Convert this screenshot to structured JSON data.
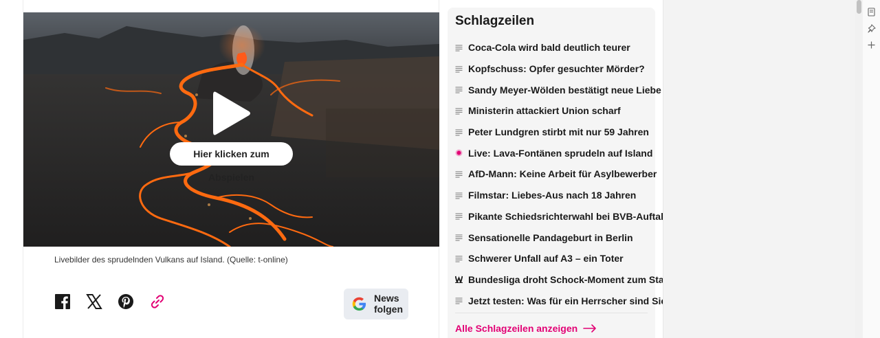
{
  "video": {
    "play_label": "Hier klicken zum Abspielen",
    "caption": "Livebilder des sprudelnden Vulkans auf Island. (Quelle: t-online)"
  },
  "share": {
    "icons": [
      "facebook-icon",
      "x-icon",
      "pinterest-icon",
      "link-icon"
    ]
  },
  "google_news": {
    "line1": "News",
    "line2": "folgen"
  },
  "headlines": {
    "title": "Schlagzeilen",
    "items": [
      {
        "text": "Coca-Cola wird bald deutlich teurer",
        "icon": "text-lines-icon"
      },
      {
        "text": "Kopfschuss: Opfer gesuchter Mörder?",
        "icon": "text-lines-icon"
      },
      {
        "text": "Sandy Meyer-Wölden bestätigt neue Liebe",
        "icon": "text-lines-icon"
      },
      {
        "text": "Ministerin attackiert Union scharf",
        "icon": "text-lines-icon"
      },
      {
        "text": "Peter Lundgren stirbt mit nur 59 Jahren",
        "icon": "text-lines-icon"
      },
      {
        "text": "Live: Lava-Fontänen sprudeln auf Island",
        "icon": "live-dot-icon"
      },
      {
        "text": "AfD-Mann: Keine Arbeit für Asylbewerber",
        "icon": "text-lines-icon"
      },
      {
        "text": "Filmstar: Liebes-Aus nach 18 Jahren",
        "icon": "text-lines-icon"
      },
      {
        "text": "Pikante Schiedsrichterwahl bei BVB-Auftakt",
        "icon": "text-lines-icon"
      },
      {
        "text": "Sensationelle Pandageburt in Berlin",
        "icon": "text-lines-icon"
      },
      {
        "text": "Schwerer Unfall auf A3 – ein Toter",
        "icon": "text-lines-icon"
      },
      {
        "text": "Bundesliga droht Schock-Moment zum Start",
        "icon": "w-logo-icon"
      },
      {
        "text": "Jetzt testen: Was für ein Herrscher sind Sie?",
        "icon": "text-lines-icon"
      }
    ],
    "all_link": "Alle Schlagzeilen anzeigen"
  },
  "colors": {
    "accent": "#e20074",
    "lava": "#ff6a10"
  }
}
